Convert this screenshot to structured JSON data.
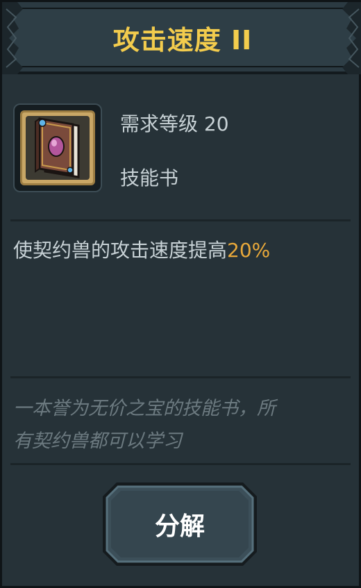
{
  "header": {
    "title": "攻击速度 II"
  },
  "item": {
    "icon": "skill-book-icon",
    "required_level": "需求等级 20",
    "type": "技能书"
  },
  "description": {
    "text": "使契约兽的攻击速度提高",
    "highlight": "20%"
  },
  "flavor": {
    "line1": "一本誉为无价之宝的技能书，所",
    "line2": "有契约兽都可以学习"
  },
  "actions": {
    "decompose_label": "分解"
  },
  "colors": {
    "title": "#f3cc4d",
    "highlight": "#e9a93a",
    "body_text": "#c8d2d6",
    "flavor_text": "#6c7a80",
    "panel_bg": "#263238"
  }
}
